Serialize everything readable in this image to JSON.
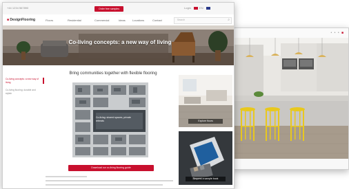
{
  "front_window": {
    "top_bar": {
      "util_left": "+44 1234 567890",
      "pill_label": "Order free samples",
      "util_right_items": [
        "Login",
        "EN"
      ]
    },
    "navbar": {
      "logo_brand": "■",
      "logo_text": "DesignFlooring",
      "nav_items": [
        "Floors",
        "Residential",
        "Commercial",
        "Ideas",
        "Locations",
        "Contact"
      ],
      "search_placeholder": "Search"
    },
    "hero": {
      "title": "Co-living concepts: a new way of living"
    },
    "sidebar": {
      "items": [
        "Co-living concepts: a new way of living",
        "Co-living flooring: durable and stylish"
      ]
    },
    "main": {
      "heading": "Bring communities together with flexible flooring",
      "infographic_caption": "Co-living: shared spaces, private retreats",
      "cta_label": "Download our co-living flooring guide"
    },
    "cards": [
      {
        "label": "Explore floors"
      },
      {
        "label": "Request a sample book"
      }
    ]
  },
  "colors": {
    "brand_red": "#c8102e",
    "chair_yellow": "#e8c81e"
  },
  "icons": [
    "search-icon",
    "flag-icon",
    "chevron-icon"
  ]
}
